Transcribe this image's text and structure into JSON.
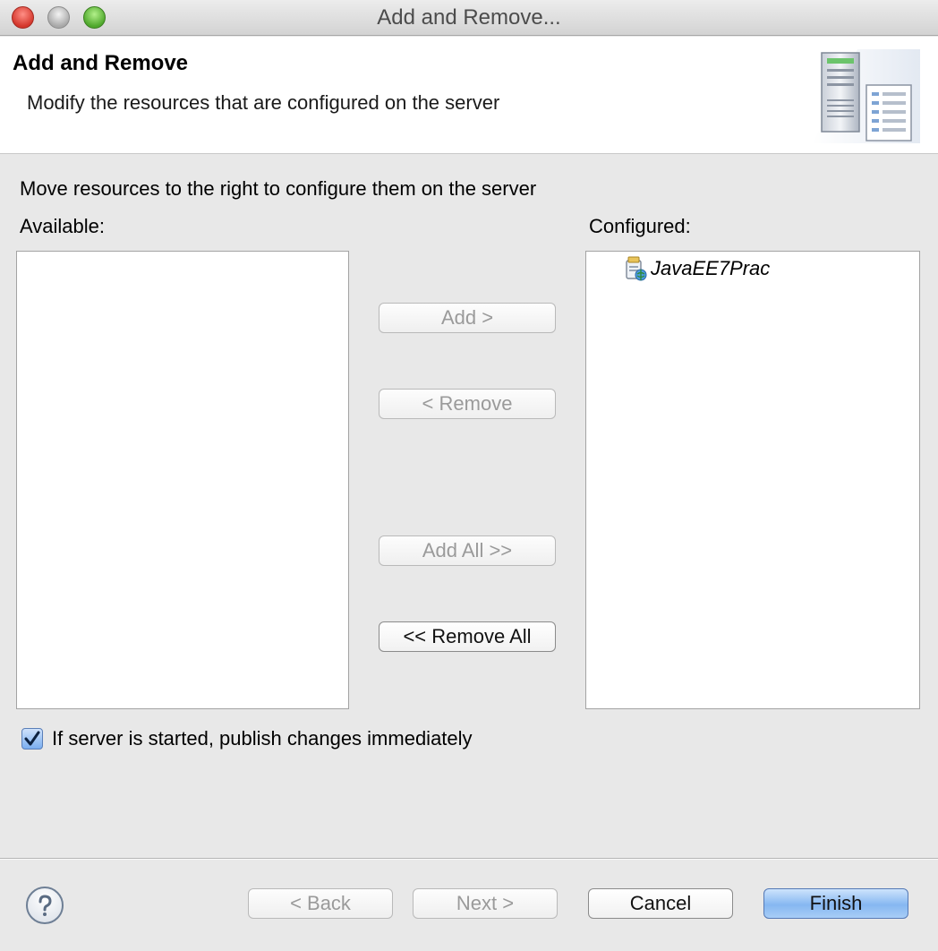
{
  "window": {
    "title": "Add and Remove..."
  },
  "header": {
    "title": "Add and Remove",
    "description": "Modify the resources that are configured on the server"
  },
  "body": {
    "instructions": "Move resources to the right to configure them on the server",
    "available_label": "Available:",
    "configured_label": "Configured:",
    "available_items": [],
    "configured_items": [
      {
        "label": "JavaEE7Prac",
        "icon": "web-project-icon"
      }
    ]
  },
  "buttons": {
    "add": "Add >",
    "remove": "< Remove",
    "add_all": "Add All >>",
    "remove_all": "<< Remove All"
  },
  "options": {
    "publish_label": "If server is started, publish changes immediately",
    "publish_checked": true
  },
  "footer": {
    "back": "< Back",
    "next": "Next >",
    "cancel": "Cancel",
    "finish": "Finish"
  }
}
